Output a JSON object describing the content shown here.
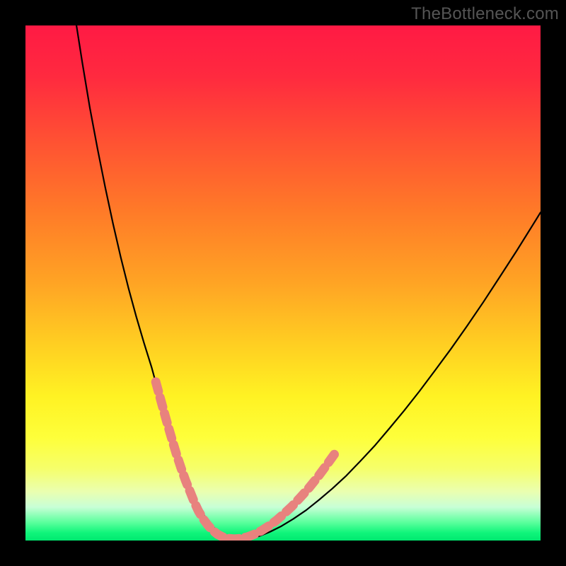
{
  "watermark": "TheBottleneck.com",
  "gradient": {
    "stops": [
      {
        "offset": 0.0,
        "color": "#ff1a44"
      },
      {
        "offset": 0.1,
        "color": "#ff2a3f"
      },
      {
        "offset": 0.22,
        "color": "#ff5033"
      },
      {
        "offset": 0.36,
        "color": "#ff7a28"
      },
      {
        "offset": 0.5,
        "color": "#ffa424"
      },
      {
        "offset": 0.62,
        "color": "#ffcf22"
      },
      {
        "offset": 0.72,
        "color": "#fff223"
      },
      {
        "offset": 0.8,
        "color": "#feff3a"
      },
      {
        "offset": 0.86,
        "color": "#f6ff6a"
      },
      {
        "offset": 0.905,
        "color": "#eaffb0"
      },
      {
        "offset": 0.935,
        "color": "#c8ffd6"
      },
      {
        "offset": 0.965,
        "color": "#5aff9c"
      },
      {
        "offset": 0.985,
        "color": "#10f57a"
      },
      {
        "offset": 1.0,
        "color": "#00e870"
      }
    ]
  },
  "chart_data": {
    "type": "line",
    "title": "",
    "xlabel": "",
    "ylabel": "",
    "xlim": [
      0,
      100
    ],
    "ylim": [
      0,
      100
    ],
    "grid": false,
    "series": [
      {
        "name": "curve",
        "stroke": "#000000",
        "stroke_width": 2.2,
        "x": [
          9.9,
          11.0,
          12.5,
          14.0,
          15.5,
          17.0,
          18.5,
          20.0,
          21.5,
          23.0,
          24.5,
          25.7,
          27.0,
          28.2,
          29.3,
          30.3,
          31.3,
          32.3,
          33.3,
          34.3,
          35.4,
          36.5,
          37.7,
          39.0,
          40.5,
          42.0,
          43.7,
          45.5,
          47.5,
          49.7,
          52.0,
          54.5,
          57.0,
          59.6,
          62.3,
          65.0,
          67.8,
          70.6,
          73.5,
          76.5,
          79.5,
          82.6,
          85.7,
          88.9,
          92.1,
          95.4,
          98.7,
          100.0
        ],
        "y": [
          100.0,
          93.0,
          84.0,
          76.0,
          68.5,
          61.5,
          55.0,
          49.0,
          43.5,
          38.4,
          33.6,
          29.2,
          25.1,
          21.4,
          18.0,
          14.9,
          12.1,
          9.6,
          7.4,
          5.5,
          3.9,
          2.6,
          1.6,
          0.9,
          0.4,
          0.2,
          0.4,
          0.9,
          1.7,
          2.8,
          4.2,
          5.9,
          7.9,
          10.1,
          12.6,
          15.4,
          18.4,
          21.7,
          25.2,
          29.0,
          33.0,
          37.2,
          41.6,
          46.3,
          51.2,
          56.3,
          61.6,
          63.7
        ]
      },
      {
        "name": "salmon-markers",
        "stroke": "#e8827e",
        "stroke_width": 13,
        "dash": [
          14,
          9
        ],
        "x": [
          25.3,
          26.4,
          27.4,
          28.4,
          29.3,
          30.2,
          31.1,
          32.0,
          32.8,
          33.6,
          34.5,
          35.4,
          36.3,
          37.3,
          38.3,
          39.4,
          40.6,
          41.8,
          43.1,
          44.4,
          45.8,
          47.2,
          48.7,
          50.2,
          51.8,
          53.4,
          55.1,
          56.8,
          58.5,
          60.3
        ],
        "y": [
          30.8,
          26.8,
          23.2,
          19.8,
          16.8,
          14.1,
          11.6,
          9.4,
          7.4,
          5.7,
          4.2,
          3.0,
          2.0,
          1.2,
          0.7,
          0.4,
          0.3,
          0.4,
          0.7,
          1.2,
          1.9,
          2.8,
          3.9,
          5.2,
          6.7,
          8.4,
          10.3,
          12.4,
          14.7,
          17.2
        ]
      }
    ]
  }
}
